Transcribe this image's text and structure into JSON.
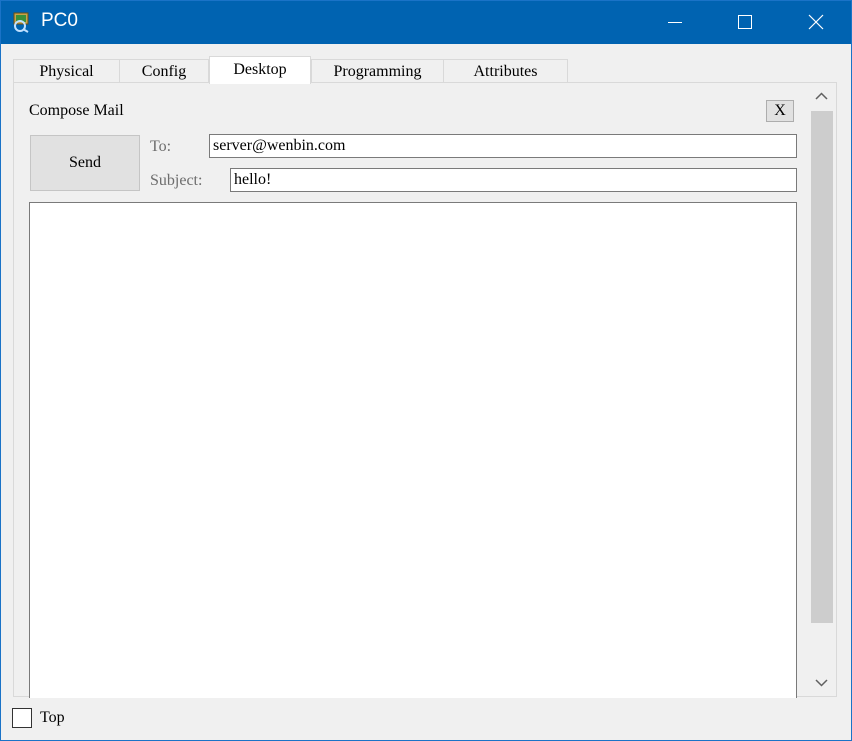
{
  "window": {
    "title": "PC0",
    "icon": "pc-app-icon",
    "controls": [
      "minimize-icon",
      "maximize-icon",
      "close-icon"
    ],
    "accent_color": "#0063b1"
  },
  "tabs": [
    {
      "label": "Physical",
      "active": false
    },
    {
      "label": "Config",
      "active": false
    },
    {
      "label": "Desktop",
      "active": true
    },
    {
      "label": "Programming",
      "active": false
    },
    {
      "label": "Attributes",
      "active": false
    }
  ],
  "compose": {
    "title": "Compose Mail",
    "close_label": "X",
    "send_label": "Send",
    "to_label": "To:",
    "to_value": "server@wenbin.com",
    "subject_label": "Subject:",
    "subject_value": "hello!",
    "body_value": ""
  },
  "footer": {
    "top_label": "Top",
    "top_checked": false
  }
}
